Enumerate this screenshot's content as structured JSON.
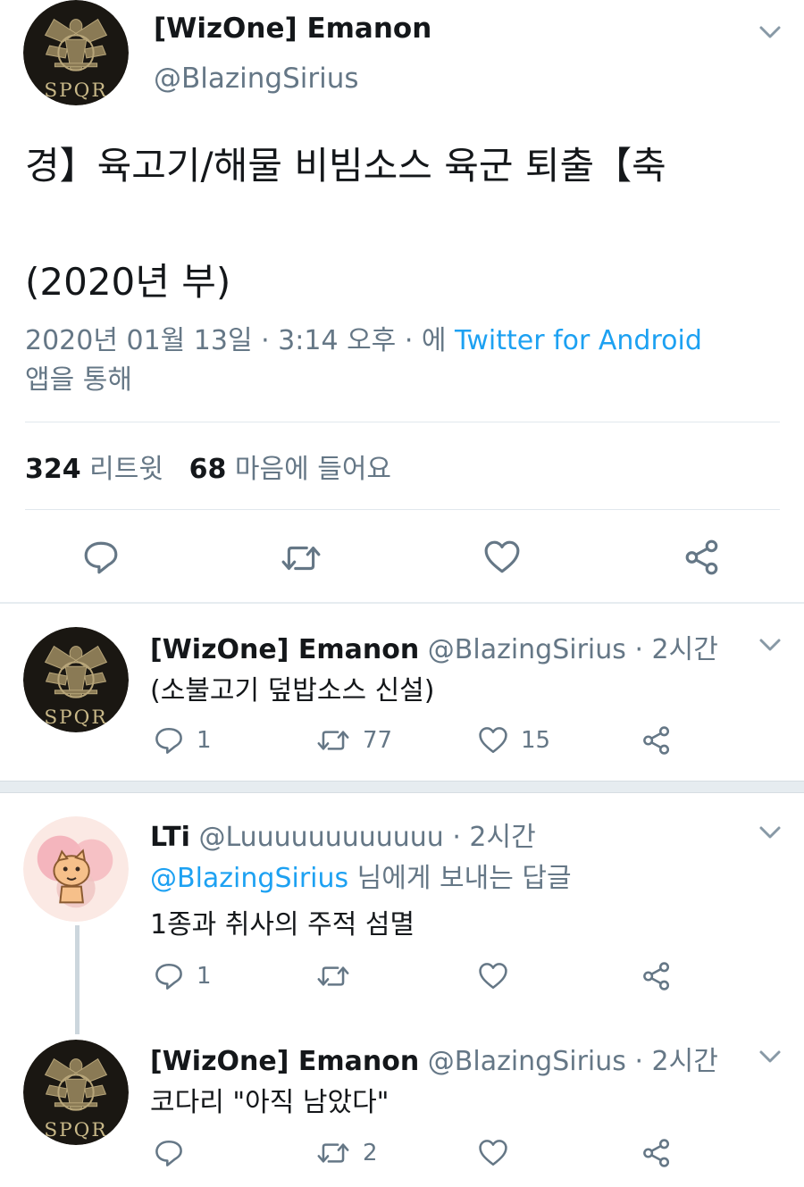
{
  "main_tweet": {
    "author_name": "[WizOne] Emanon",
    "author_handle": "@BlazingSirius",
    "text_line1": "경】육고기/해물 비빔소스 육군 퇴출【축",
    "text_line2": "(2020년 부)",
    "date_time": "2020년 01월 13일 · 3:14 오후 · 에 ",
    "source_link": "Twitter for Android",
    "via": "앱을 통해",
    "retweet_count": "324",
    "retweet_label": "리트윗",
    "like_count": "68",
    "like_label": "마음에 들어요",
    "avatar_text": "SPQR"
  },
  "replies": [
    {
      "author_name": "[WizOne] Emanon",
      "author_handle": "@BlazingSirius",
      "time": " · 2시간",
      "text": "(소불고기 덮밥소스 신설)",
      "reply_count": "1",
      "retweet_count": "77",
      "like_count": "15",
      "avatar_text": "SPQR"
    },
    {
      "author_name": "LTi",
      "author_handle": "@Luuuuuuuuuuuu",
      "time": " · 2시간",
      "reply_to_handle": "@BlazingSirius",
      "reply_to_suffix": " 님에게 보내는 답글",
      "text": "1종과 취사의 주적 섬멸",
      "reply_count": "1",
      "retweet_count": "",
      "like_count": ""
    },
    {
      "author_name": "[WizOne] Emanon",
      "author_handle": "@BlazingSirius",
      "time": " · 2시간",
      "text": "코다리 \"아직 남았다\"",
      "reply_count": "",
      "retweet_count": "2",
      "like_count": "",
      "avatar_text": "SPQR"
    }
  ],
  "colors": {
    "text_primary": "#14171a",
    "text_secondary": "#657786",
    "link": "#1da1f2",
    "divider": "#e1e8ed"
  },
  "icons": [
    "chevron-down-icon",
    "reply-icon",
    "retweet-icon",
    "like-icon",
    "share-icon"
  ]
}
